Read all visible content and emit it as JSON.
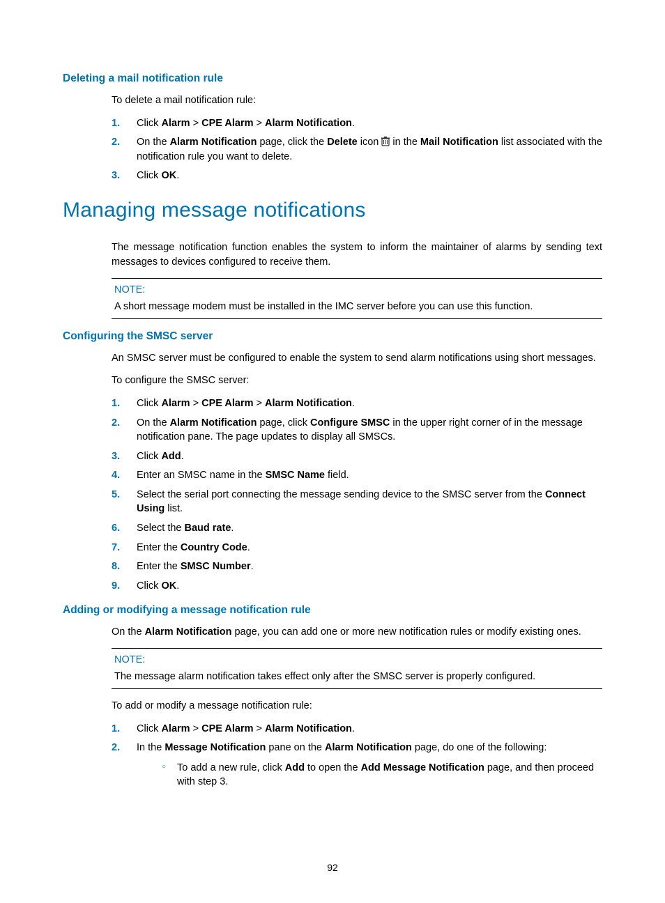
{
  "section1": {
    "heading": "Deleting a mail notification rule",
    "intro": "To delete a mail notification rule:",
    "steps": [
      {
        "n": "1.",
        "pre": "Click ",
        "b1": "Alarm",
        "sep1": " > ",
        "b2": "CPE Alarm",
        "sep2": " > ",
        "b3": "Alarm Notification",
        "post": "."
      },
      {
        "n": "2.",
        "pre": "On the ",
        "b1": "Alarm Notification",
        "mid1": " page, click the ",
        "b2": "Delete",
        "mid2": " icon ",
        "icon": true,
        "mid3": " in the ",
        "b3": "Mail Notification",
        "post": " list associated with the notification rule you want to delete."
      },
      {
        "n": "3.",
        "pre": "Click ",
        "b1": "OK",
        "post": "."
      }
    ]
  },
  "section2": {
    "heading": "Managing message notifications",
    "para": "The message notification function enables the system to inform the maintainer of alarms by sending text messages to devices configured to receive them.",
    "note": {
      "label": "NOTE:",
      "text": "A short message modem must be installed in the IMC server before you can use this function."
    }
  },
  "section3": {
    "heading": "Configuring the SMSC server",
    "para1": "An SMSC server must be configured to enable the system to send alarm notifications using short messages.",
    "para2": "To configure the SMSC server:",
    "steps": [
      {
        "n": "1.",
        "pre": "Click ",
        "b1": "Alarm",
        "sep1": " > ",
        "b2": "CPE Alarm",
        "sep2": " > ",
        "b3": "Alarm Notification",
        "post": "."
      },
      {
        "n": "2.",
        "pre": "On the ",
        "b1": "Alarm Notification",
        "mid1": " page, click ",
        "b2": "Configure SMSC",
        "post": " in the upper right corner of in the message notification pane. The page updates to display all SMSCs."
      },
      {
        "n": "3.",
        "pre": "Click ",
        "b1": "Add",
        "post": "."
      },
      {
        "n": "4.",
        "pre": "Enter an SMSC name in the ",
        "b1": "SMSC Name",
        "post": " field."
      },
      {
        "n": "5.",
        "pre": "Select the serial port connecting the message sending device to the SMSC server from the ",
        "b1": "Connect Using",
        "post": " list."
      },
      {
        "n": "6.",
        "pre": "Select the ",
        "b1": "Baud rate",
        "post": "."
      },
      {
        "n": "7.",
        "pre": "Enter the ",
        "b1": "Country Code",
        "post": "."
      },
      {
        "n": "8.",
        "pre": "Enter the ",
        "b1": "SMSC Number",
        "post": "."
      },
      {
        "n": "9.",
        "pre": "Click ",
        "b1": "OK",
        "post": "."
      }
    ]
  },
  "section4": {
    "heading": "Adding or modifying a message notification rule",
    "para1_pre": "On the ",
    "para1_b": "Alarm Notification",
    "para1_post": " page, you can add one or more new notification rules or modify existing ones.",
    "note": {
      "label": "NOTE:",
      "text": "The message alarm notification takes effect only after the SMSC server is properly configured."
    },
    "para2": "To add or modify a message notification rule:",
    "steps": [
      {
        "n": "1.",
        "pre": "Click ",
        "b1": "Alarm",
        "sep1": " > ",
        "b2": "CPE Alarm",
        "sep2": " > ",
        "b3": "Alarm Notification",
        "post": "."
      },
      {
        "n": "2.",
        "pre": "In the ",
        "b1": "Message Notification",
        "mid1": " pane on the ",
        "b2": "Alarm Notification",
        "post": " page, do one of the following:",
        "sub": [
          {
            "pre": "To add a new rule, click ",
            "b1": "Add",
            "mid1": " to open the ",
            "b2": "Add Message Notification",
            "post": " page, and then proceed with step 3."
          }
        ]
      }
    ]
  },
  "pageNumber": "92"
}
